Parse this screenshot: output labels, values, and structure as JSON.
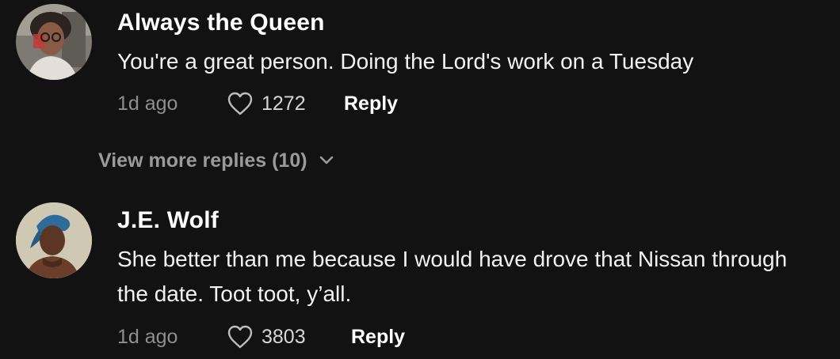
{
  "comments": [
    {
      "username": "Always the Queen",
      "text": "You're a great person. Doing the Lord's work on a Tuesday",
      "time": "1d ago",
      "likes": "1272",
      "reply_label": "Reply"
    },
    {
      "username": "J.E. Wolf",
      "text": "She better than me because I would have drove that Nissan through the date. Toot toot, y’all.",
      "time": "1d ago",
      "likes": "3803",
      "reply_label": "Reply"
    }
  ],
  "view_more": {
    "label": "View more replies (10)"
  },
  "icons": {
    "like": "heart-outline-icon",
    "expand": "chevron-down-icon"
  },
  "colors": {
    "background": "#121212",
    "text_primary": "#ffffff",
    "text_secondary": "#8e8e8e"
  }
}
